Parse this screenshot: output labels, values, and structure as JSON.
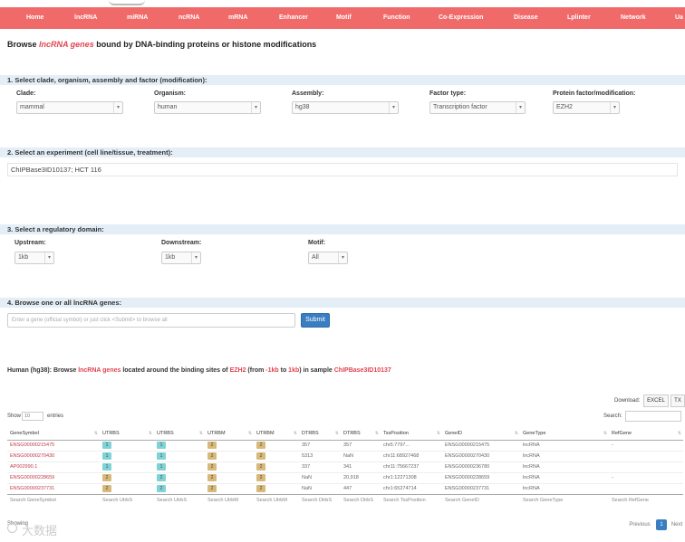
{
  "nav": [
    "Home",
    "lncRNA",
    "miRNA",
    "ncRNA",
    "mRNA",
    "Enhancer",
    "Motif",
    "Function",
    "Co-Expression",
    "Disease",
    "Lplinter",
    "Network",
    "Ua"
  ],
  "title": {
    "pre": "Browse ",
    "hl": "lncRNA genes",
    "post": " bound by DNA-binding proteins or histone modifications"
  },
  "step1": {
    "heading": "1. Select clade, organism, assembly and factor (modification):",
    "fields": [
      {
        "label": "Clade:",
        "value": "mammal"
      },
      {
        "label": "Organism:",
        "value": "human"
      },
      {
        "label": "Assembly:",
        "value": "hg38"
      },
      {
        "label": "Factor type:",
        "value": "Transcription factor"
      },
      {
        "label": "Protein factor/modification:",
        "value": "EZH2"
      }
    ]
  },
  "step2": {
    "heading": "2. Select an experiment (cell line/tissue, treatment):",
    "value": "ChIPBase3ID10137; HCT 116"
  },
  "step3": {
    "heading": "3. Select a regulatory domain:",
    "fields": [
      {
        "label": "Upstream:",
        "value": "1kb"
      },
      {
        "label": "Downstream:",
        "value": "1kb"
      },
      {
        "label": "Motif:",
        "value": "All"
      }
    ]
  },
  "step4": {
    "heading": "4. Browse one or all lncRNA genes:",
    "placeholder": "Enter a gene (official symbol) or just click <Submit> to browse all",
    "submit": "Submit"
  },
  "result": {
    "p1": "Human (hg38): Browse ",
    "hl1": "lncRNA genes",
    "p2": " located around the binding sites of ",
    "hl2": "EZH2",
    "p3": " (from ",
    "hl3": "-1kb",
    "p4": " to ",
    "hl4": "1kb",
    "p5": ") in sample ",
    "hl5": "ChIPBase3ID10137"
  },
  "download": {
    "label": "Download:",
    "excel": "EXCEL",
    "txt": "TX"
  },
  "table_controls": {
    "show": "Show",
    "show_value": "10",
    "entries": "entries",
    "search": "Search:"
  },
  "table": {
    "headers": [
      "GeneSymbol",
      "UTRBS",
      "UTRBS",
      "UTRBM",
      "UTRBM",
      "DTRBS",
      "DTRBS",
      "TssPosition",
      "GeneID",
      "GeneType",
      "RefGene"
    ],
    "rows": [
      [
        "ENSG00000215475",
        "1",
        "1",
        "2",
        "2",
        "357",
        "357",
        "chr5:7797...",
        "ENSG00000215475",
        "lncRNA",
        "-"
      ],
      [
        "ENSG00000270430",
        "1",
        "1",
        "2",
        "2",
        "5313",
        "NaN",
        "chr11:68927468",
        "ENSG00000270430",
        "lncRNA",
        ""
      ],
      [
        "AP002990.1",
        "1",
        "1",
        "2",
        "2",
        "337",
        "341",
        "chr11:75667237",
        "ENSG00000236780",
        "lncRNA",
        ""
      ],
      [
        "ENSG00000228659",
        "2",
        "2",
        "2",
        "2",
        "NaN",
        "20,918",
        "chr1:12271308",
        "ENSG00000228659",
        "lncRNA",
        "-"
      ],
      [
        "ENSG00000237731",
        "2",
        "2",
        "2",
        "2",
        "NaN",
        "447",
        "chr1:65274714",
        "ENSG00000237731",
        "lncRNA",
        ""
      ]
    ],
    "footer": [
      "Search GeneSymbol",
      "Search UtrbS",
      "Search UtrbS",
      "Search UtrbM",
      "Search UtrbM",
      "Search DtrbS",
      "Search DtrbS",
      "Search TssPosition",
      "Search GeneID",
      "Search GeneType",
      "Search RefGene"
    ]
  },
  "info": "Showing",
  "watermark": "大数据",
  "pagination": {
    "prev": "Previous",
    "page": "1",
    "next": "Next"
  },
  "colors": {
    "nav": "#f06a6a",
    "step": "#e4eef6",
    "accent": "#e0454f",
    "submit": "#3a7ec2"
  }
}
